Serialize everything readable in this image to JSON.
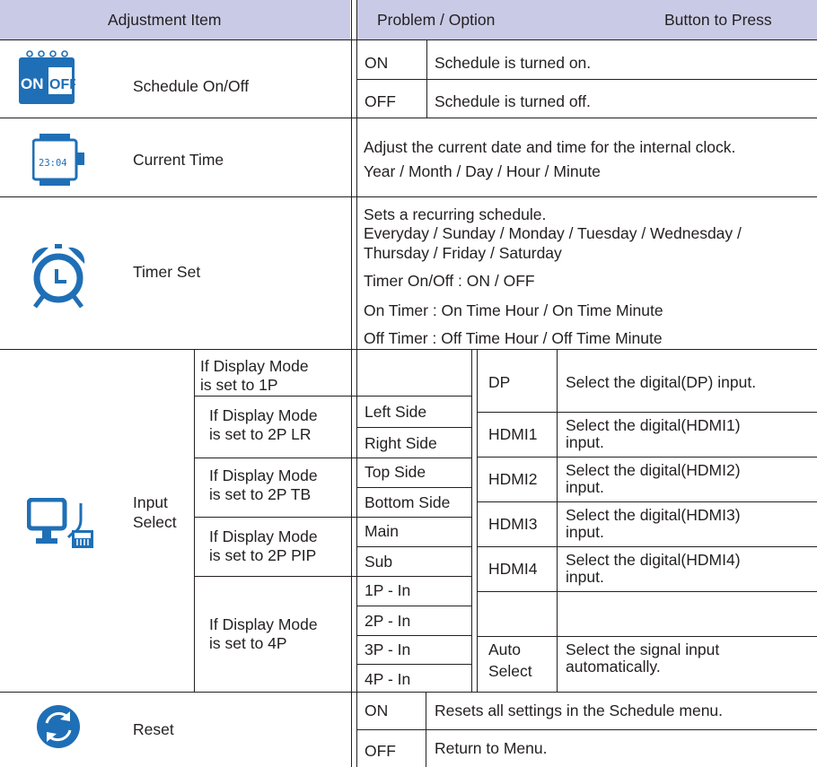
{
  "header": {
    "adjustment_item": "Adjustment Item",
    "problem_option": "Problem / Option",
    "button_to_press": "Button to Press"
  },
  "schedule": {
    "label": "Schedule On/Off",
    "icon": "on-off-calendar-icon",
    "icon_on": "ON",
    "icon_off": "OFF",
    "options": [
      {
        "key": "ON",
        "desc": "Schedule is turned on."
      },
      {
        "key": "OFF",
        "desc": "Schedule is turned off."
      }
    ]
  },
  "current_time": {
    "label": "Current Time",
    "icon": "clock-display-icon",
    "icon_text": "23:04",
    "lines": [
      "Adjust the current date and time for the internal clock.",
      "Year / Month / Day / Hour / Minute"
    ]
  },
  "timer_set": {
    "label": "Timer Set",
    "icon": "alarm-clock-icon",
    "lines": [
      "Sets a recurring schedule.",
      "Everyday / Sunday / Monday / Tuesday / Wednesday /",
      "Thursday / Friday / Saturday",
      "Timer On/Off : ON / OFF",
      "On Timer : On Time Hour / On Time Minute",
      "Off Timer : Off Time Hour / Off Time Minute"
    ]
  },
  "input_select": {
    "label_1": "Input",
    "label_2": "Select",
    "icon": "monitor-plug-icon",
    "modes": [
      {
        "l1": "If Display Mode",
        "l2": "is set to 1P"
      },
      {
        "l1": "If Display Mode",
        "l2": "is set to 2P LR"
      },
      {
        "l1": "If Display Mode",
        "l2": "is set to 2P TB"
      },
      {
        "l1": "If Display Mode",
        "l2": "is set to 2P PIP"
      },
      {
        "l1": "If Display Mode",
        "l2": "is set to 4P"
      }
    ],
    "sides": [
      "Left Side",
      "Right Side",
      "Top Side",
      "Bottom Side",
      "Main",
      "Sub",
      "1P - In",
      "2P - In",
      "3P - In",
      "4P - In"
    ],
    "inputs": [
      {
        "k1": "DP",
        "k2": "",
        "d1": "Select the digital(DP) input.",
        "d2": ""
      },
      {
        "k1": "HDMI1",
        "k2": "",
        "d1": "Select the digital(HDMI1)",
        "d2": "input."
      },
      {
        "k1": "HDMI2",
        "k2": "",
        "d1": "Select the digital(HDMI2)",
        "d2": "input."
      },
      {
        "k1": "HDMI3",
        "k2": "",
        "d1": "Select the digital(HDMI3)",
        "d2": "input."
      },
      {
        "k1": "HDMI4",
        "k2": "",
        "d1": "Select the digital(HDMI4)",
        "d2": "input."
      },
      {
        "k1": "Auto",
        "k2": "Select",
        "d1": "Select the signal input",
        "d2": "automatically."
      }
    ]
  },
  "reset": {
    "label": "Reset",
    "icon": "refresh-circle-icon",
    "options": [
      {
        "key": "ON",
        "desc": "Resets all settings in the Schedule menu."
      },
      {
        "key": "OFF",
        "desc": "Return to Menu."
      }
    ]
  },
  "colors": {
    "header_bg": "#c9cbe6",
    "icon_blue": "#1f6fb6",
    "line": "#231f20"
  }
}
